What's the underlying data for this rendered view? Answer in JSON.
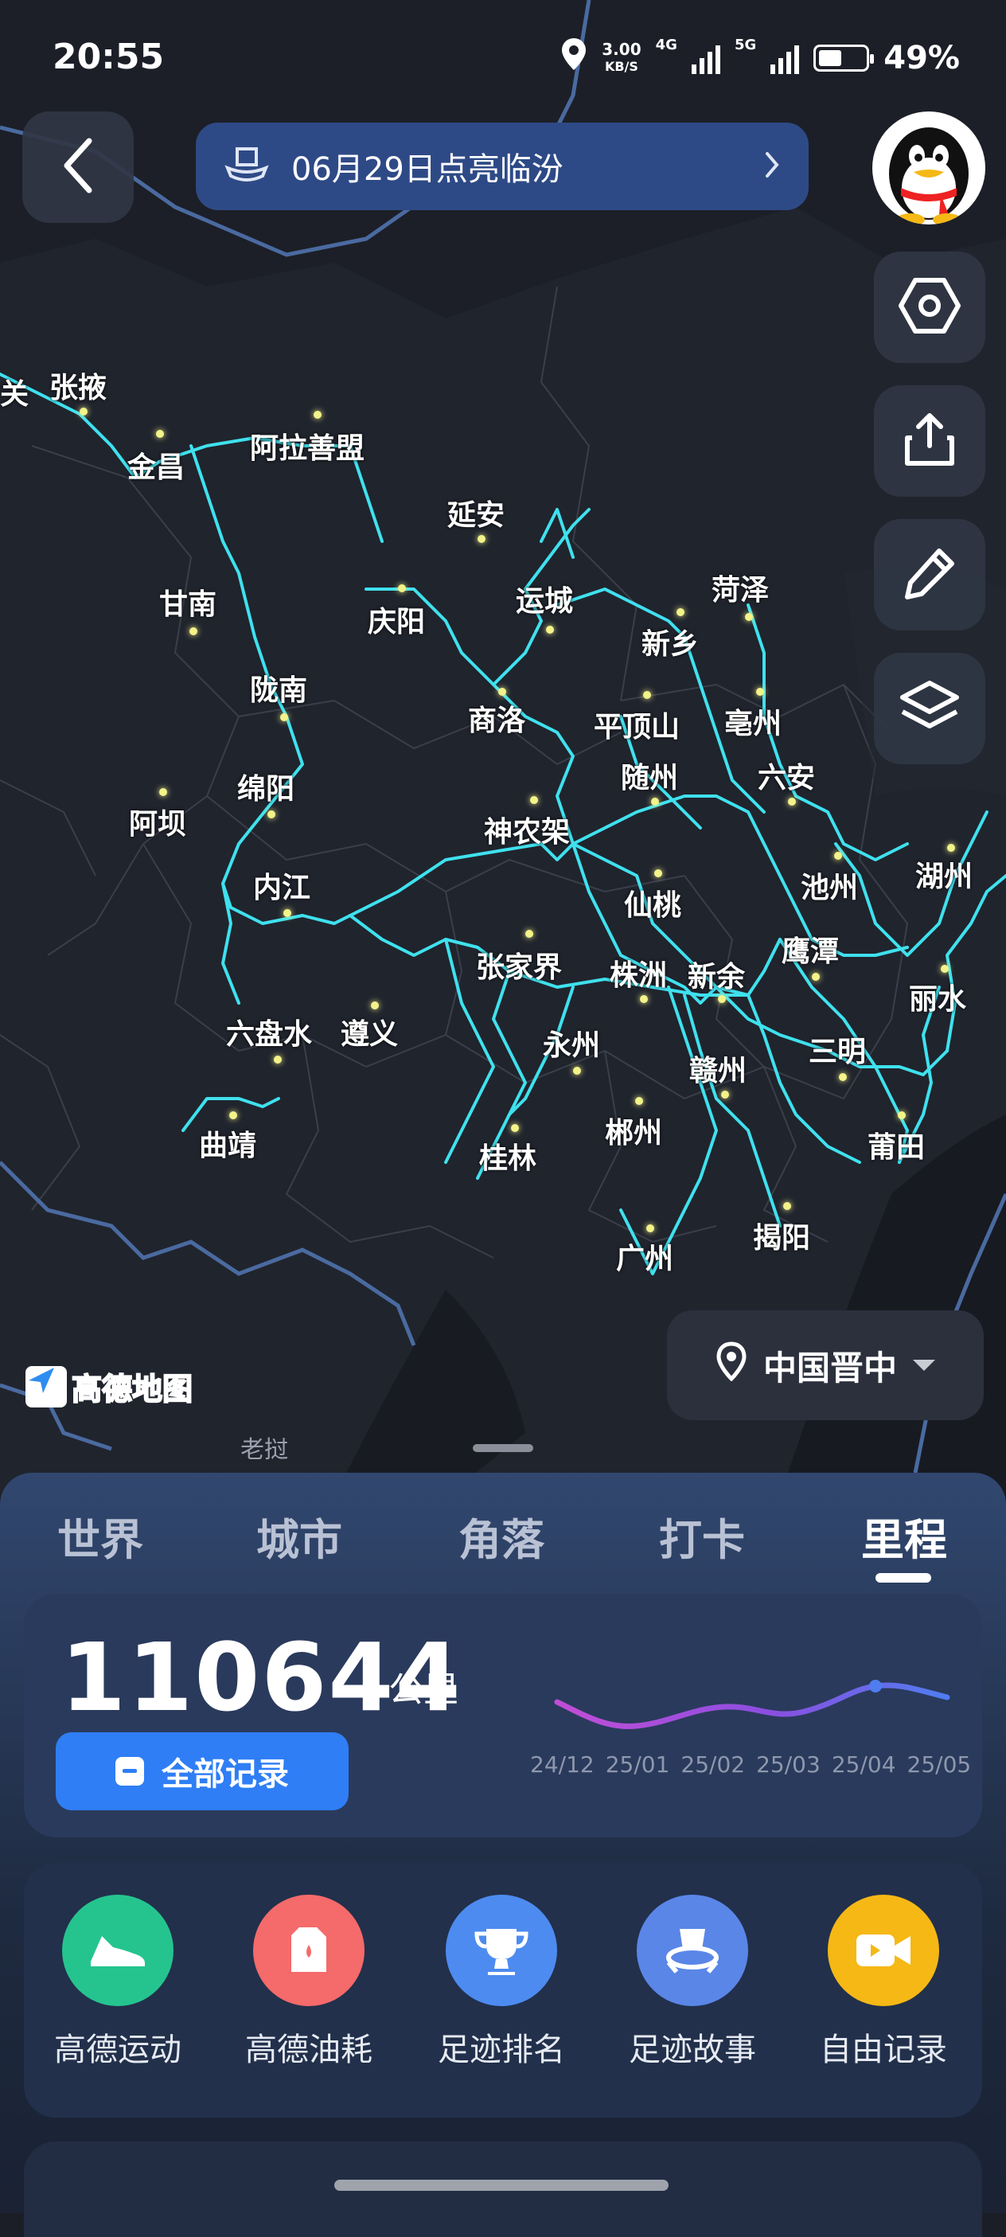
{
  "status_bar": {
    "time": "20:55",
    "net_speed": "3.00",
    "net_unit": "KB/S",
    "net_4g": "4G",
    "net_5g": "5G",
    "battery": "49%"
  },
  "header": {
    "banner_text": "06月29日点亮临汾",
    "back_icon": "chevron-left-icon",
    "banner_icon": "hat-icon"
  },
  "side_buttons": [
    "hexagon-icon",
    "share-icon",
    "pen-icon",
    "layers-icon"
  ],
  "map": {
    "labels": [
      {
        "name": "张掖"
      },
      {
        "name": "金昌"
      },
      {
        "name": "阿拉善盟"
      },
      {
        "name": "延安"
      },
      {
        "name": "甘南"
      },
      {
        "name": "庆阳"
      },
      {
        "name": "运城"
      },
      {
        "name": "菏泽"
      },
      {
        "name": "新乡"
      },
      {
        "name": "陇南"
      },
      {
        "name": "商洛"
      },
      {
        "name": "平顶山"
      },
      {
        "name": "亳州"
      },
      {
        "name": "绵阳"
      },
      {
        "name": "随州"
      },
      {
        "name": "六安"
      },
      {
        "name": "阿坝"
      },
      {
        "name": "神农架"
      },
      {
        "name": "内江"
      },
      {
        "name": "仙桃"
      },
      {
        "name": "池州"
      },
      {
        "name": "湖州"
      },
      {
        "name": "张家界"
      },
      {
        "name": "株洲"
      },
      {
        "name": "新余"
      },
      {
        "name": "鹰潭"
      },
      {
        "name": "丽水"
      },
      {
        "name": "六盘水"
      },
      {
        "name": "遵义"
      },
      {
        "name": "永州"
      },
      {
        "name": "三明"
      },
      {
        "name": "赣州"
      },
      {
        "name": "曲靖"
      },
      {
        "name": "郴州"
      },
      {
        "name": "莆田"
      },
      {
        "name": "桂林"
      },
      {
        "name": "揭阳"
      },
      {
        "name": "广州"
      },
      {
        "name": "关"
      }
    ],
    "logo_text": "高德地图",
    "bottom_place": "老挝",
    "route_color": "#3fe1ee",
    "dot_color": "#f3f38a"
  },
  "region_selector": {
    "label": "中国晋中"
  },
  "tabs": [
    {
      "label": "世界"
    },
    {
      "label": "城市"
    },
    {
      "label": "角落"
    },
    {
      "label": "打卡"
    },
    {
      "label": "里程",
      "active": true
    }
  ],
  "mileage": {
    "distance": "110644",
    "unit": "公里",
    "all_records": "全部记录",
    "months": [
      "24/12",
      "25/01",
      "25/02",
      "25/03",
      "25/04",
      "25/05"
    ]
  },
  "tools": [
    {
      "label": "高德运动",
      "icon": "shoe-icon",
      "color": "#25c48f"
    },
    {
      "label": "高德油耗",
      "icon": "fuel-can-icon",
      "color": "#f56a6a"
    },
    {
      "label": "足迹排名",
      "icon": "trophy-icon",
      "color": "#4d8bf0"
    },
    {
      "label": "足迹故事",
      "icon": "hat-globe-icon",
      "color": "#5a86e8"
    },
    {
      "label": "自由记录",
      "icon": "video-camera-icon",
      "color": "#f5b815"
    }
  ]
}
